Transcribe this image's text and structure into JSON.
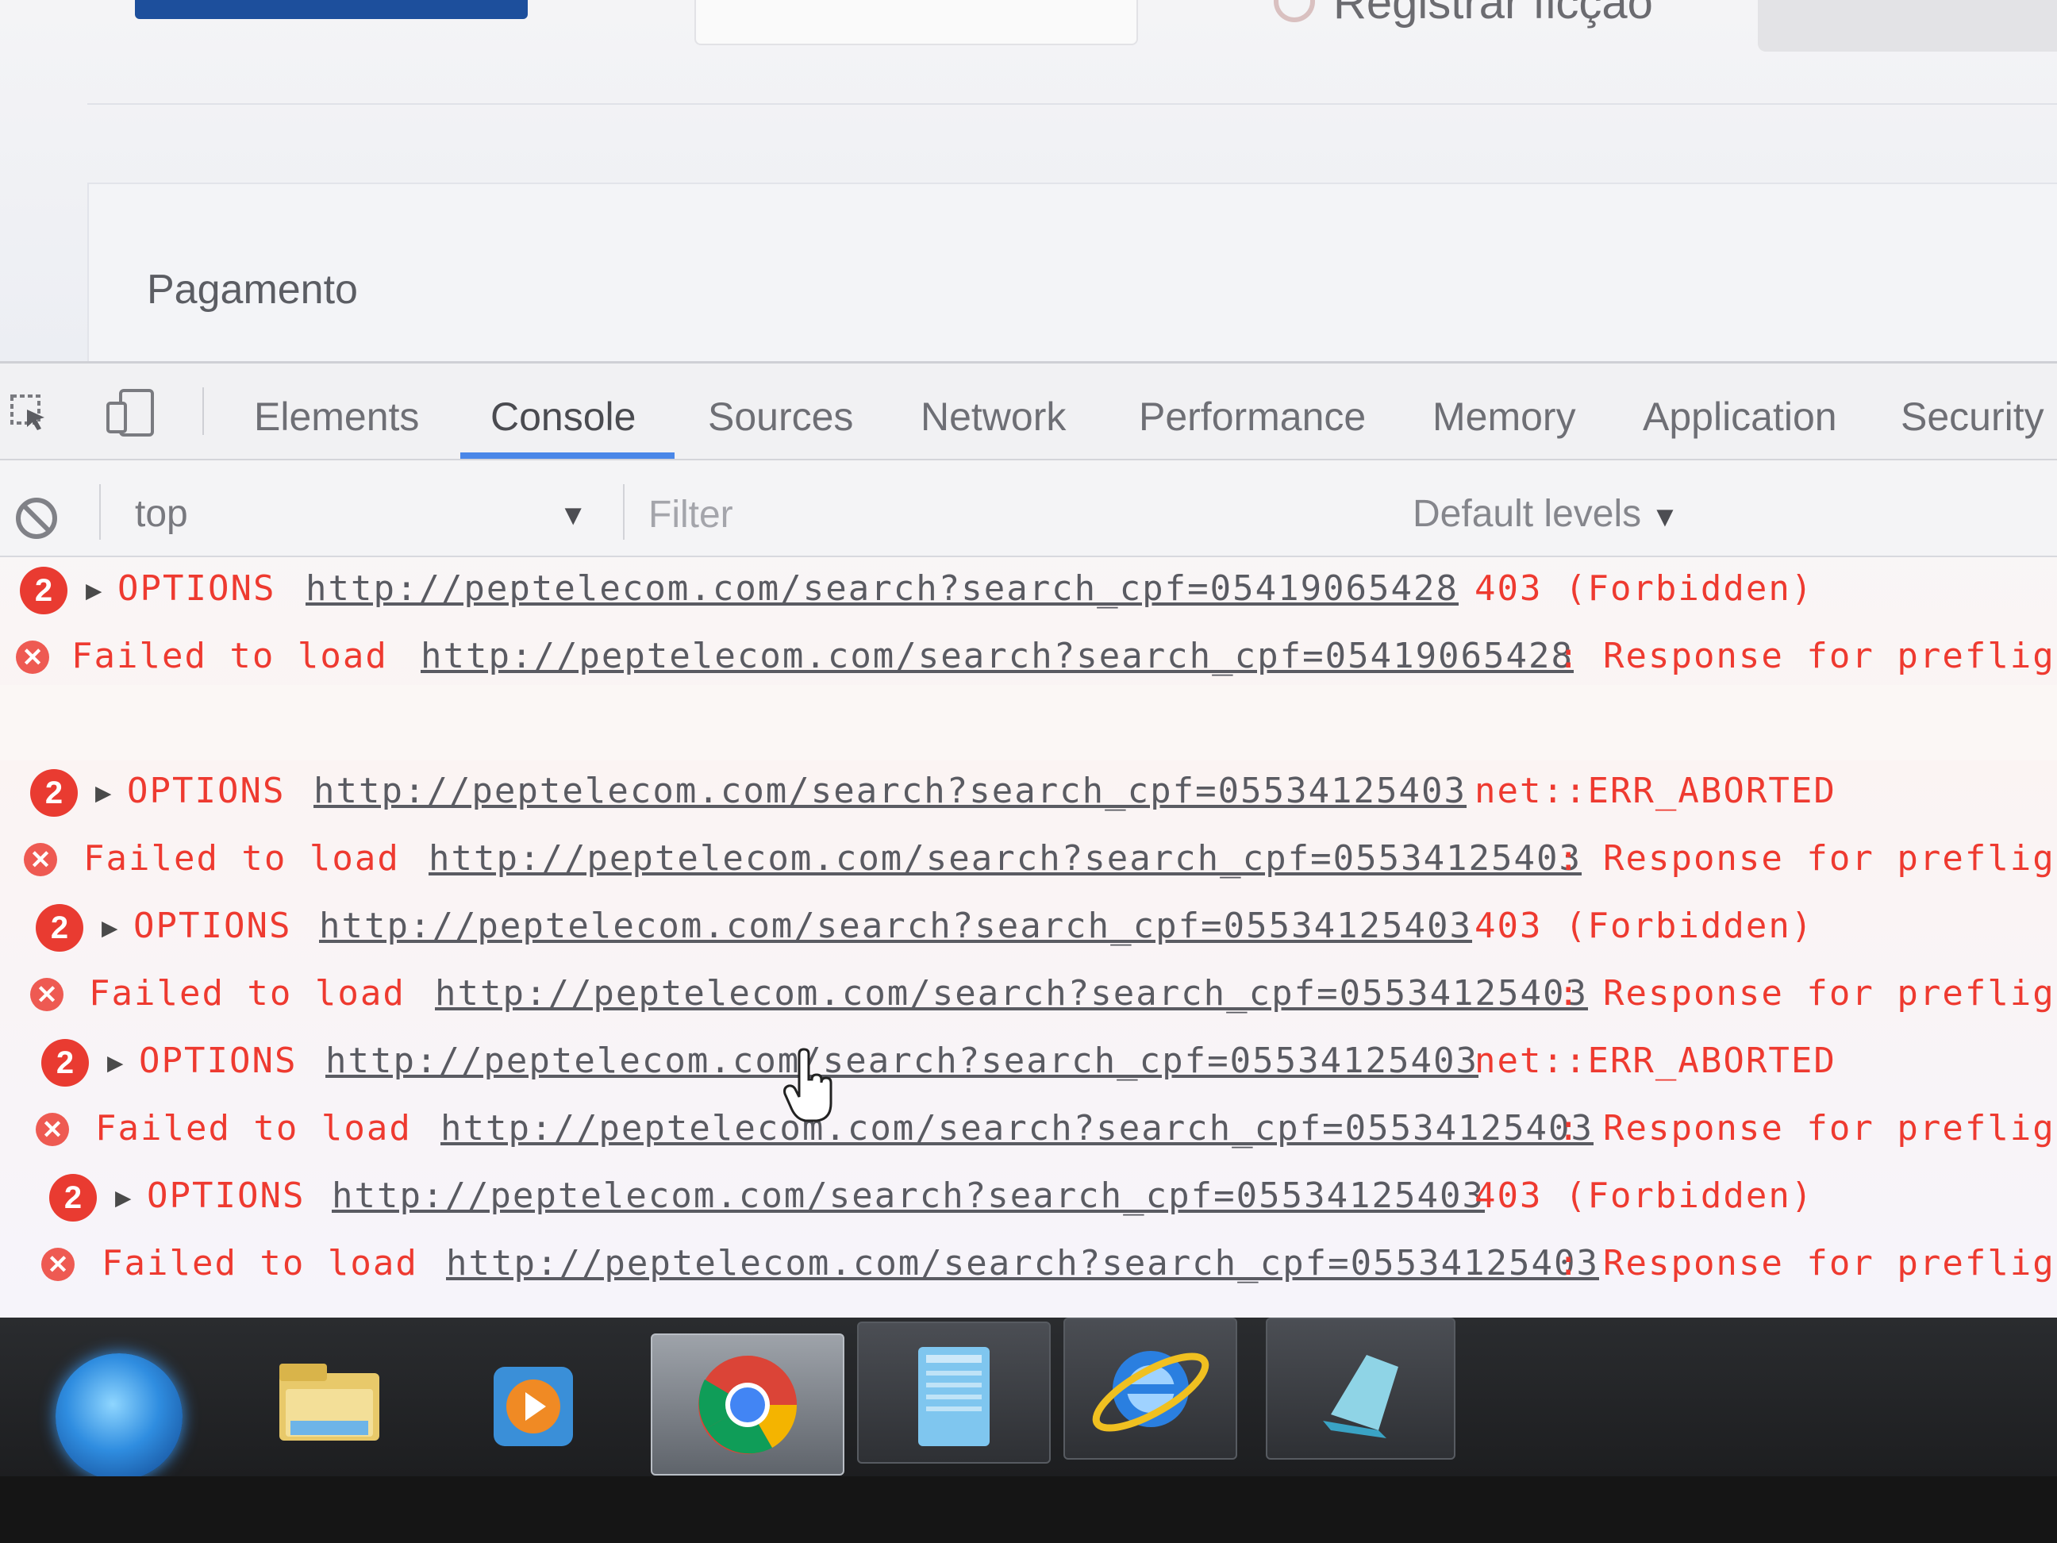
{
  "page": {
    "registrar_label": "Registrar ficção",
    "section_title": "Pagamento"
  },
  "devtools": {
    "tabs": [
      "Elements",
      "Console",
      "Sources",
      "Network",
      "Performance",
      "Memory",
      "Application",
      "Security"
    ],
    "active_tab": "Console",
    "toolbar": {
      "context": "top",
      "filter_placeholder": "Filter",
      "levels": "Default levels"
    },
    "messages": [
      {
        "type": "group",
        "count": "2",
        "method": "OPTIONS",
        "url": "http://peptelecom.com/search?search_cpf=05419065428",
        "status": "403 (Forbidden)"
      },
      {
        "type": "error",
        "prefix": "Failed to load",
        "url": "http://peptelecom.com/search?search_cpf=05419065428",
        "suffix": ": Response for preflight"
      },
      {
        "type": "group",
        "count": "2",
        "method": "OPTIONS",
        "url": "http://peptelecom.com/search?search_cpf=05534125403",
        "status": "net::ERR_ABORTED"
      },
      {
        "type": "error",
        "prefix": "Failed to load",
        "url": "http://peptelecom.com/search?search_cpf=05534125403",
        "suffix": ": Response for preflight"
      },
      {
        "type": "group",
        "count": "2",
        "method": "OPTIONS",
        "url": "http://peptelecom.com/search?search_cpf=05534125403",
        "status": "403 (Forbidden)"
      },
      {
        "type": "error",
        "prefix": "Failed to load",
        "url": "http://peptelecom.com/search?search_cpf=05534125403",
        "suffix": ": Response for preflight"
      },
      {
        "type": "group",
        "count": "2",
        "method": "OPTIONS",
        "url": "http://peptelecom.com/search?search_cpf=05534125403",
        "status": "net::ERR_ABORTED"
      },
      {
        "type": "error",
        "prefix": "Failed to load",
        "url": "http://peptelecom.com/search?search_cpf=05534125403",
        "suffix": ": Response for preflight"
      },
      {
        "type": "group",
        "count": "2",
        "method": "OPTIONS",
        "url": "http://peptelecom.com/search?search_cpf=05534125403",
        "status": "403 (Forbidden)"
      },
      {
        "type": "error",
        "prefix": "Failed to load",
        "url": "http://peptelecom.com/search?search_cpf=05534125403",
        "suffix": ": Response for preflight"
      }
    ]
  },
  "taskbar": {
    "items": [
      "start-orb-icon",
      "file-explorer-icon",
      "media-player-icon",
      "chrome-icon",
      "notepad-icon",
      "internet-explorer-icon",
      "folder-app-icon"
    ],
    "active": "chrome-icon"
  },
  "colors": {
    "error_red": "#ee3a30",
    "tab_underline": "#4a87e8",
    "badge_red": "#e93b31"
  }
}
